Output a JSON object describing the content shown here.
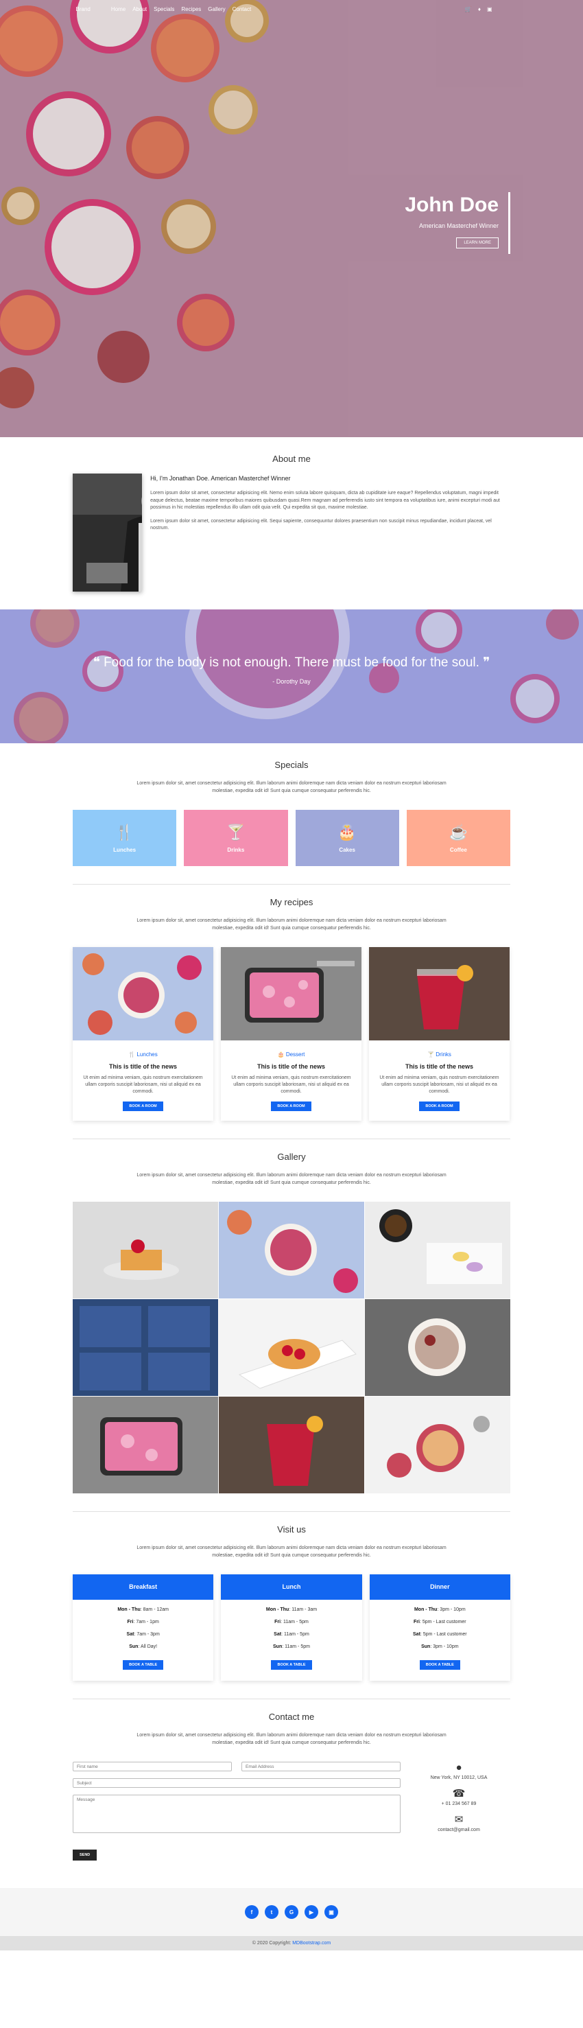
{
  "nav": {
    "brand": "Brand",
    "links": [
      "Home",
      "About",
      "Specials",
      "Recipes",
      "Gallery",
      "Contact"
    ],
    "icons": [
      "cart-icon",
      "twitter-icon",
      "instagram-icon"
    ]
  },
  "hero": {
    "title": "John Doe",
    "subtitle": "American Masterchef Winner",
    "button": "LEARN MORE"
  },
  "about": {
    "heading": "About me",
    "title": "Hi, I'm Jonathan Doe. American Masterchef Winner",
    "paragraphs": [
      "Lorem ipsum dolor sit amet, consectetur adipisicing elit. Nemo enim soluta labore quisquam, dicta ab cupiditate iure eaque? Repellendus voluptatum, magni impedit eaque delectus, beatae maxime temporibus maiores quibusdam quasi.Rem magnam ad perferendis iusto sint tempora ea voluptatibus iure, animi excepturi modi aut possimus in hic molestias repellendus illo ullam odit quia velit. Qui expedita sit quo, maxime molestiae.",
      "Lorem ipsum dolor sit amet, consectetur adipisicing elit. Sequi sapiente, consequuntur dolores praesentium non suscipit minus repudiandae, incidunt placeat, vel nostrum."
    ]
  },
  "quote": {
    "text": "Food for the body is not enough. There must be food for the soul.",
    "author": "- Dorothy Day"
  },
  "intro_text": "Lorem ipsum dolor sit, amet consectetur adipisicing elit. Illum laborum animi doloremque nam dicta veniam dolor ea nostrum excepturi laboriosam molestiae, expedita odit id! Sunt quia cumque consequatur perferendis hic.",
  "specials": {
    "heading": "Specials",
    "items": [
      {
        "label": "Lunches",
        "icon": "utensils-icon",
        "color": "#90caf9"
      },
      {
        "label": "Drinks",
        "icon": "cocktail-icon",
        "color": "#f48fb1"
      },
      {
        "label": "Cakes",
        "icon": "birthday-cake-icon",
        "color": "#9fa8da"
      },
      {
        "label": "Coffee",
        "icon": "coffee-icon",
        "color": "#ffab91"
      }
    ]
  },
  "recipes": {
    "heading": "My recipes",
    "cards": [
      {
        "category": "Lunches",
        "icon": "utensils-icon",
        "title": "This is title of the news",
        "text": "Ut enim ad minima veniam, quis nostrum exercitationem ullam corporis suscipit laboriosam, nisi ut aliquid ex ea commodi.",
        "button": "BOOK A ROOM"
      },
      {
        "category": "Dessert",
        "icon": "birthday-cake-icon",
        "title": "This is title of the news",
        "text": "Ut enim ad minima veniam, quis nostrum exercitationem ullam corporis suscipit laboriosam, nisi ut aliquid ex ea commodi.",
        "button": "BOOK A ROOM"
      },
      {
        "category": "Drinks",
        "icon": "cocktail-icon",
        "title": "This is title of the news",
        "text": "Ut enim ad minima veniam, quis nostrum exercitationem ullam corporis suscipit laboriosam, nisi ut aliquid ex ea commodi.",
        "button": "BOOK A ROOM"
      }
    ]
  },
  "gallery": {
    "heading": "Gallery"
  },
  "visit": {
    "heading": "Visit us",
    "cards": [
      {
        "title": "Breakfast",
        "lines": [
          [
            "Mon - Thu",
            "8am - 12am"
          ],
          [
            "Fri",
            "7am - 1pm"
          ],
          [
            "Sat",
            "7am - 3pm"
          ],
          [
            "Sun",
            "All Day!"
          ]
        ],
        "button": "BOOK A TABLE"
      },
      {
        "title": "Lunch",
        "lines": [
          [
            "Mon - Thu",
            "11am - 3am"
          ],
          [
            "Fri",
            "11am - 5pm"
          ],
          [
            "Sat",
            "11am - 5pm"
          ],
          [
            "Sun",
            "11am - 5pm"
          ]
        ],
        "button": "BOOK A TABLE"
      },
      {
        "title": "Dinner",
        "lines": [
          [
            "Mon - Thu",
            "3pm - 10pm"
          ],
          [
            "Fri",
            "5pm - Last customer"
          ],
          [
            "Sat",
            "5pm - Last customer"
          ],
          [
            "Sun",
            "3pm - 10pm"
          ]
        ],
        "button": "BOOK A TABLE"
      }
    ]
  },
  "contact": {
    "heading": "Contact me",
    "first_name": "First name",
    "email": "Email Address",
    "subject": "Subject",
    "message": "Message",
    "send": "SEND",
    "address": "New York, NY 10012, USA",
    "phone": "+ 01 234 567 89",
    "mail": "contact@gmail.com"
  },
  "footer": {
    "socials": [
      "facebook-icon",
      "twitter-icon",
      "google-icon",
      "youtube-icon",
      "instagram-icon"
    ],
    "copyright": "© 2020 Copyright:",
    "link": "MDBootstrap.com"
  }
}
